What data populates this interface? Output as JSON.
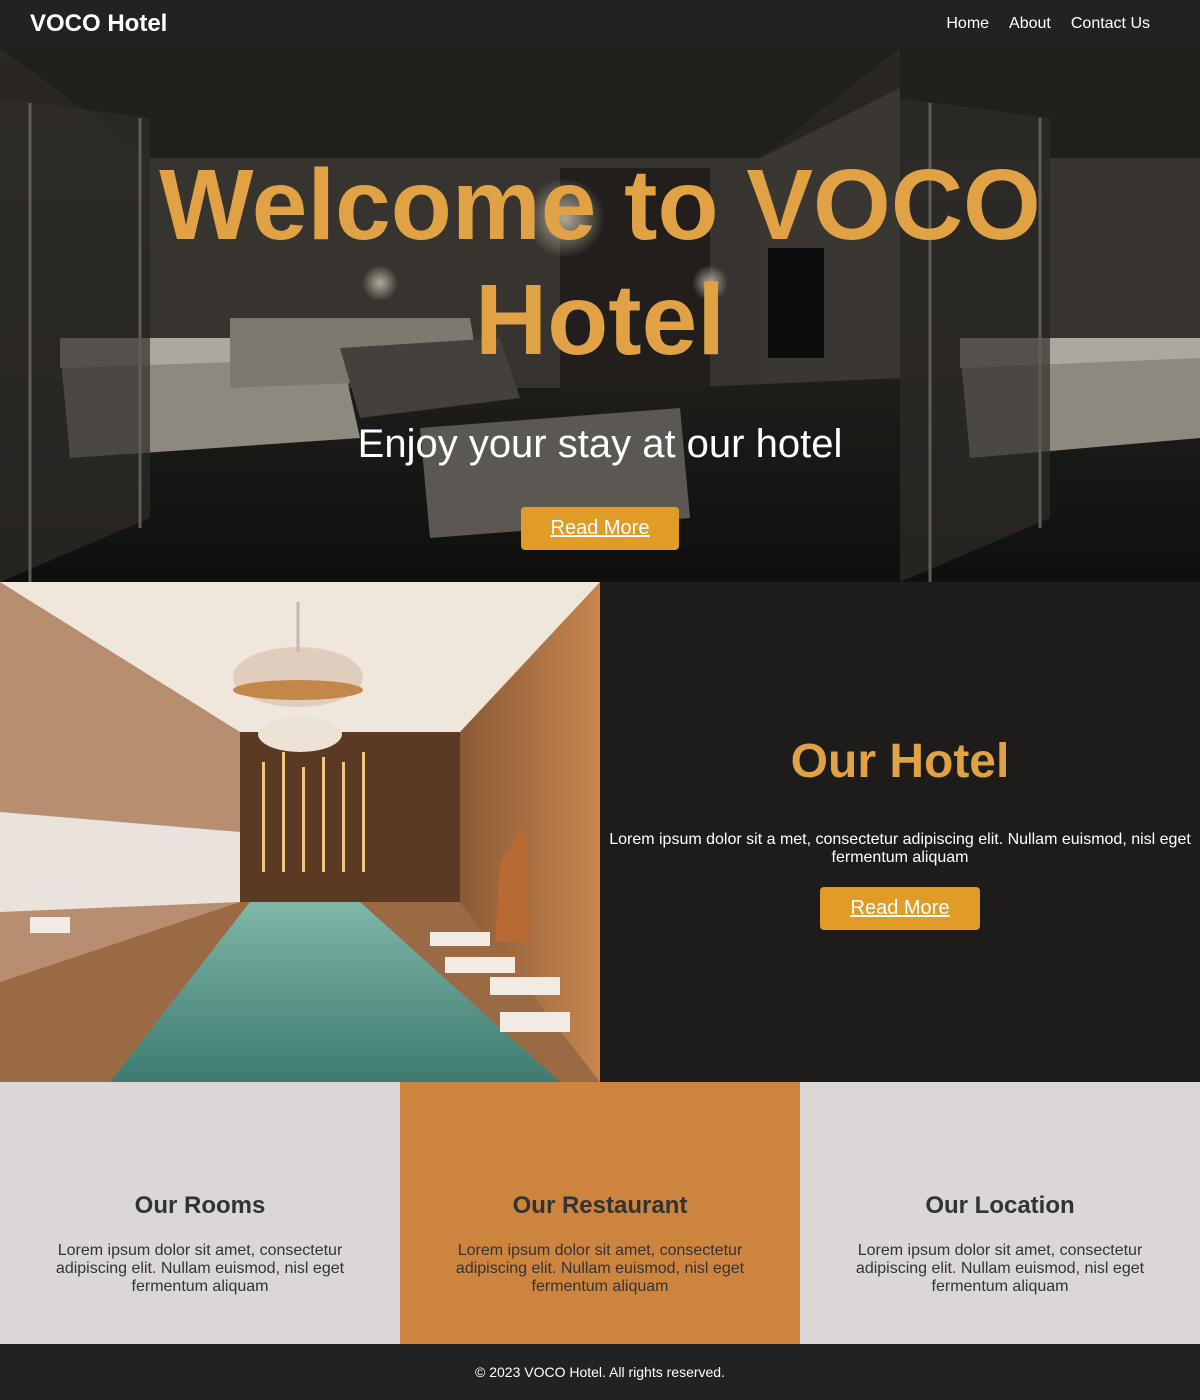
{
  "nav": {
    "brand": "VOCO Hotel",
    "links": [
      "Home",
      "About",
      "Contact Us"
    ]
  },
  "hero": {
    "title": "Welcome to VOCO Hotel",
    "subtitle": "Enjoy your stay at our hotel",
    "button": "Read More"
  },
  "hotel": {
    "title": "Our Hotel",
    "description": "Lorem ipsum dolor sit a met, consectetur adipiscing elit. Nullam euismod, nisl eget fermentum aliquam",
    "button": "Read More"
  },
  "features": [
    {
      "title": "Our Rooms",
      "text": "Lorem ipsum dolor sit amet, consectetur adipiscing elit. Nullam euismod, nisl eget fermentum aliquam"
    },
    {
      "title": "Our Restaurant",
      "text": "Lorem ipsum dolor sit amet, consectetur adipiscing elit. Nullam euismod, nisl eget fermentum aliquam"
    },
    {
      "title": "Our Location",
      "text": "Lorem ipsum dolor sit amet, consectetur adipiscing elit. Nullam euismod, nisl eget fermentum aliquam"
    }
  ],
  "footer": {
    "text": "© 2023 VOCO Hotel. All rights reserved."
  },
  "colors": {
    "accent_text": "#e0a244",
    "button": "#e19c28",
    "feature_accent": "#cd843f",
    "feature_light": "#dad7d6",
    "dark": "#1d1c1b"
  }
}
